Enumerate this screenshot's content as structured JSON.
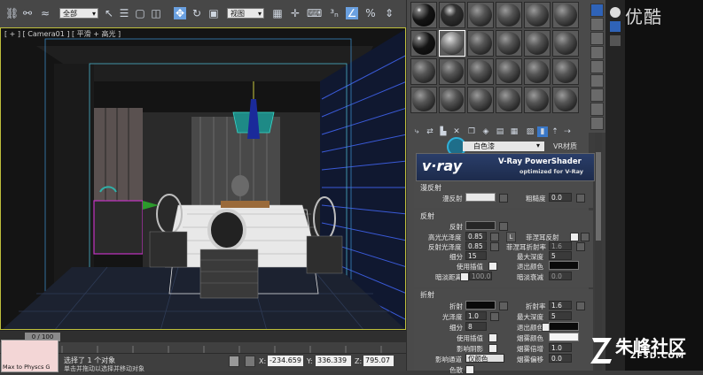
{
  "toolbar": {
    "selection_filter": "全部",
    "reference_coord": "视图",
    "icons": [
      "link-icon",
      "unlink-icon",
      "bind-icon",
      "select-icon",
      "select-by-name-icon",
      "rect-select-icon",
      "window-crossing-icon",
      "move-icon",
      "rotate-icon",
      "scale-icon",
      "pivot-icon",
      "select-manipulate-icon",
      "snap-icon",
      "angle-snap-icon",
      "percent-snap-icon",
      "spinner-snap-icon"
    ]
  },
  "viewport": {
    "label": "[ + ] [ Camera01 ] [ 平滑 + 高光 ]"
  },
  "timeline": {
    "frame": "0 / 100"
  },
  "status": {
    "maxscript": "Max to Physcs G",
    "message": "选择了 1 个对象",
    "prompt": "单击并拖动以选择并移动对象",
    "x_label": "X:",
    "x_value": "-234.659",
    "y_label": "Y:",
    "y_value": "336.339",
    "z_label": "Z:",
    "z_value": "795.07"
  },
  "material_editor": {
    "material_name": "白色漆",
    "material_type": "VR材质",
    "banner": {
      "logo": "v·ray",
      "title": "V-Ray PowerShader",
      "subtitle": "optimized for V-Ray"
    },
    "diffuse": {
      "header": "漫反射",
      "diffuse_label": "漫反射",
      "roughness_label": "粗糙度",
      "roughness_value": "0.0",
      "diffuse_color": "#e8e8e8"
    },
    "reflection": {
      "header": "反射",
      "reflect_label": "反射",
      "hilight_gloss_label": "高光光泽度",
      "hilight_gloss_value": "0.85",
      "lock_label": "L",
      "fresnel_label": "菲涅耳反射",
      "refl_gloss_label": "反射光泽度",
      "refl_gloss_value": "0.85",
      "fresnel_ior_label": "菲涅耳折射率",
      "fresnel_ior_value": "1.6",
      "subdivs_label": "细分",
      "subdivs_value": "15",
      "max_depth_label": "最大深度",
      "max_depth_value": "5",
      "use_interp_label": "使用插值",
      "exit_color_label": "退出颜色",
      "dim_distance_label": "暗淡距离",
      "dim_distance_value": "100.0",
      "dim_falloff_label": "暗淡衰减",
      "dim_falloff_value": "0.0",
      "reflect_color": "#262626",
      "exit_color": "#0a0a0a"
    },
    "refraction": {
      "header": "折射",
      "refract_label": "折射",
      "ior_label": "折射率",
      "ior_value": "1.6",
      "gloss_label": "光泽度",
      "gloss_value": "1.0",
      "max_depth_label": "最大深度",
      "max_depth_value": "5",
      "subdivs_label": "细分",
      "subdivs_value": "8",
      "exit_color_label": "退出颜色",
      "use_interp_label": "使用插值",
      "fog_color_label": "烟雾颜色",
      "affect_shadows_label": "影响阴影",
      "fog_multiplier_label": "烟雾倍增",
      "fog_multiplier_value": "1.0",
      "affect_channels_label": "影响通道",
      "affect_channels_value": "仅颜色",
      "fog_bias_label": "烟雾偏移",
      "fog_bias_value": "0.0",
      "dispersion_label": "色散",
      "refract_color": "#0a0a0a",
      "fog_color": "#f4f4f4"
    }
  },
  "watermark": {
    "top": "优酷",
    "brand": "朱峰社区",
    "url": "ZF3D.COM"
  }
}
